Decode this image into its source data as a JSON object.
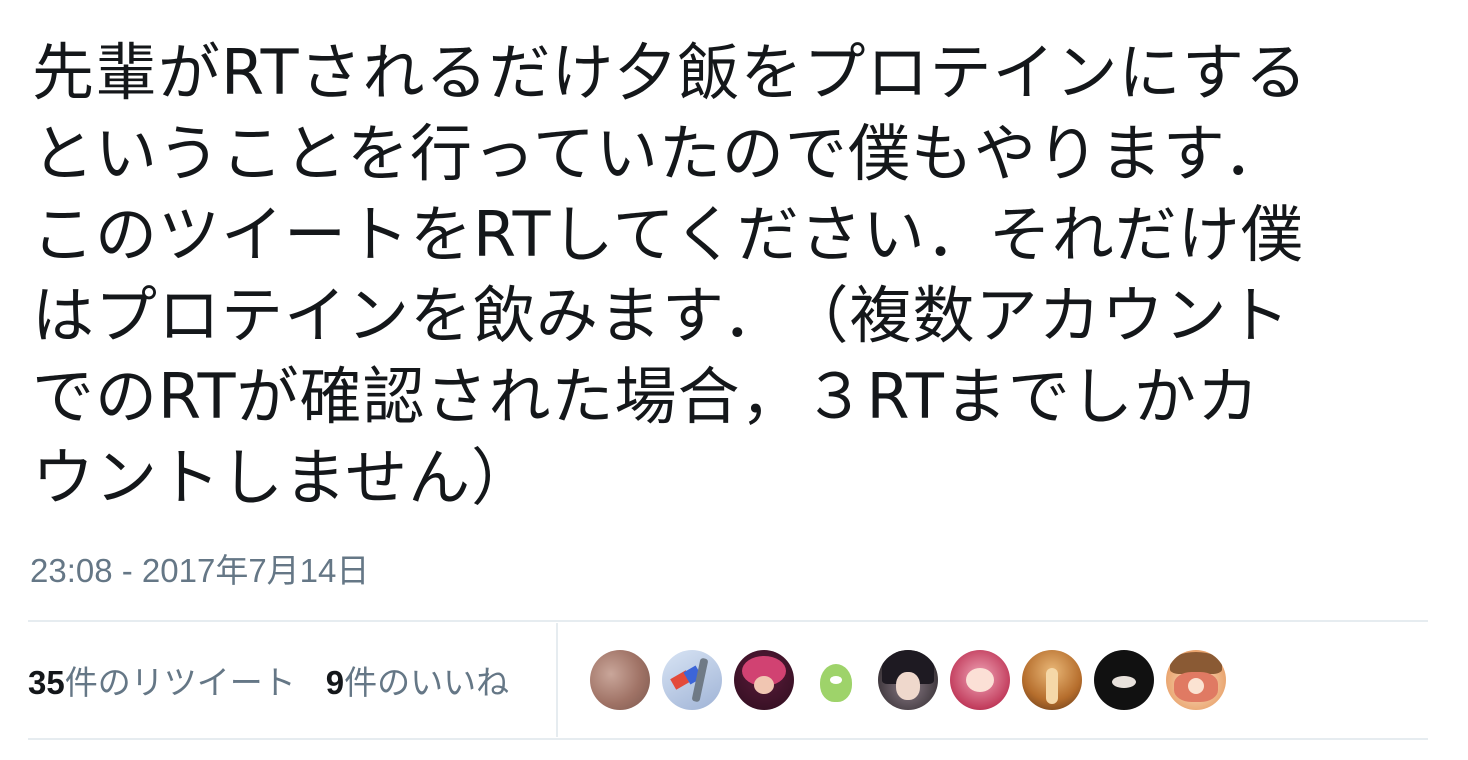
{
  "tweet": {
    "text": "先輩がRTされるだけ夕飯をプロテインにする\nということを行っていたので僕もやります．\nこのツイートをRTしてください．それだけ僕\nはプロテインを飲みます．　（複数アカウント\nでのRTが確認された場合，３RTまでしかカ\nウントしません）",
    "timestamp": "23:08 - 2017年7月14日"
  },
  "stats": {
    "retweets": {
      "count": "35",
      "label": "件のリツイート"
    },
    "likes": {
      "count": "9",
      "label": "件のいいね"
    }
  },
  "colors": {
    "text": "#14171a",
    "secondary": "#657786",
    "divider": "#e6ecf0"
  }
}
